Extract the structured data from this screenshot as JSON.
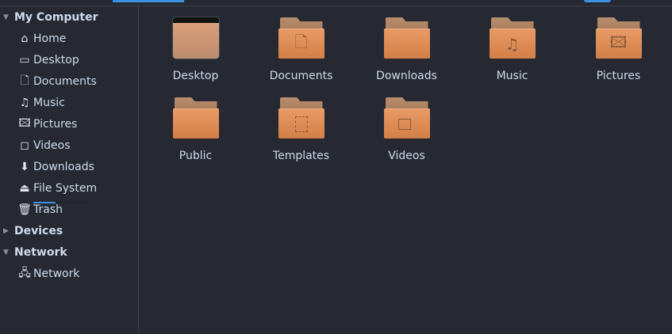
{
  "sidebar": {
    "sections": [
      {
        "label": "My Computer",
        "expanded": true,
        "items": [
          {
            "label": "Home",
            "icon": "home-icon"
          },
          {
            "label": "Desktop",
            "icon": "desktop-icon"
          },
          {
            "label": "Documents",
            "icon": "document-icon"
          },
          {
            "label": "Music",
            "icon": "music-icon"
          },
          {
            "label": "Pictures",
            "icon": "pictures-icon"
          },
          {
            "label": "Videos",
            "icon": "video-icon"
          },
          {
            "label": "Downloads",
            "icon": "download-icon"
          },
          {
            "label": "File System",
            "icon": "drive-icon",
            "usage_fraction": 0.4
          },
          {
            "label": "Trash",
            "icon": "trash-icon"
          }
        ]
      },
      {
        "label": "Devices",
        "expanded": false,
        "items": []
      },
      {
        "label": "Network",
        "expanded": true,
        "items": [
          {
            "label": "Network",
            "icon": "network-icon"
          }
        ]
      }
    ]
  },
  "folders": [
    {
      "label": "Desktop",
      "icon": "desktop-folder-icon"
    },
    {
      "label": "Documents",
      "icon": "document-icon"
    },
    {
      "label": "Downloads",
      "icon": "none"
    },
    {
      "label": "Music",
      "icon": "music-icon"
    },
    {
      "label": "Pictures",
      "icon": "pictures-icon"
    },
    {
      "label": "Public",
      "icon": "none"
    },
    {
      "label": "Templates",
      "icon": "template-icon"
    },
    {
      "label": "Videos",
      "icon": "video-icon"
    }
  ],
  "colors": {
    "accent": "#3d8fe0",
    "folder": "#e08d58",
    "background": "#262932"
  }
}
